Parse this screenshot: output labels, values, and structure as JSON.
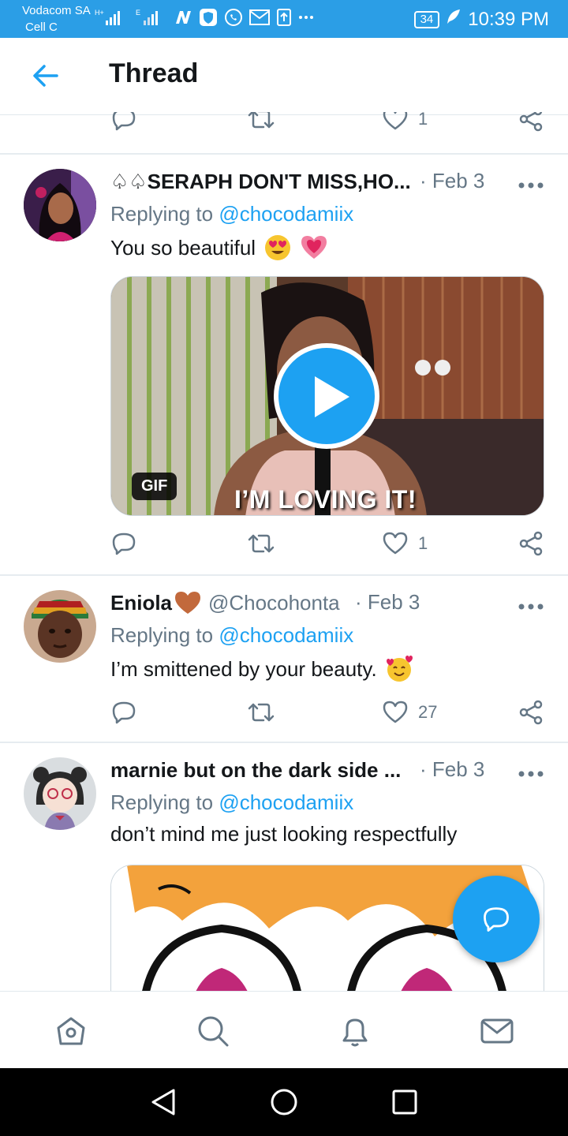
{
  "status_bar": {
    "carrier1": "Vodacom SA",
    "carrier2": "Cell C",
    "battery": "34",
    "time": "10:39 PM",
    "net1": "H+",
    "net2": "E"
  },
  "header": {
    "title": "Thread"
  },
  "prev_tweet_actions": {
    "likes": "1"
  },
  "tweets": [
    {
      "name": "♤♤SERAPH DON'T MISS,HO...",
      "handle": "",
      "date": "· Feb 3",
      "replying_label": "Replying to",
      "replying_handle": "@chocodamiix",
      "text": "You so beautiful",
      "media": {
        "badge": "GIF",
        "caption": "I’M LOVING IT!"
      },
      "likes": "1",
      "retweets": ""
    },
    {
      "name": "Eniola",
      "handle": "@Chocohonta",
      "date": "· Feb 3",
      "replying_label": "Replying to",
      "replying_handle": "@chocodamiix",
      "text": "I’m smittened by your beauty.",
      "likes": "27",
      "retweets": ""
    },
    {
      "name": "marnie but on the dark side ...",
      "handle": "",
      "date": "· Feb 3",
      "replying_label": "Replying to",
      "replying_handle": "@chocodamiix",
      "text": "don’t mind me just looking respectfully"
    }
  ],
  "colors": {
    "accent": "#1da1f2",
    "status_bar": "#2b9ee6",
    "muted": "#657786"
  },
  "icons": {
    "back": "arrow-left-icon",
    "reply": "comment-icon",
    "retweet": "retweet-icon",
    "like": "heart-icon",
    "share": "share-icon",
    "more": "more-icon",
    "compose": "compose-reply-icon",
    "home": "home-icon",
    "search": "search-icon",
    "notifications": "bell-icon",
    "messages": "mail-icon"
  }
}
